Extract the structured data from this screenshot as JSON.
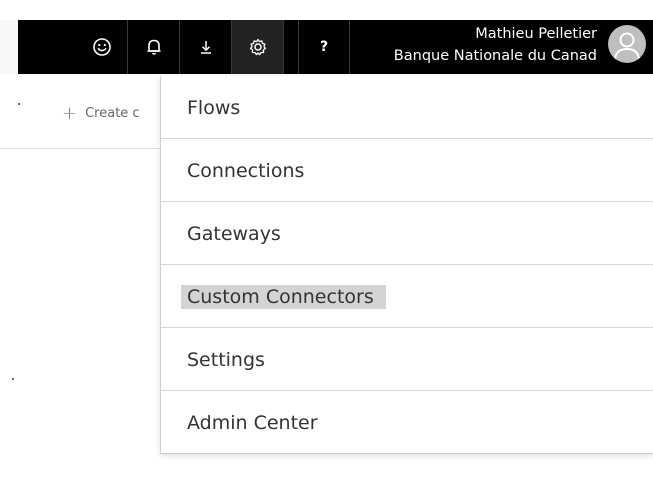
{
  "header": {
    "user_name": "Mathieu Pelletier",
    "user_org": "Banque Nationale du Canad",
    "buttons": [
      {
        "icon": "smiley-icon"
      },
      {
        "icon": "bell-icon"
      },
      {
        "icon": "download-icon"
      },
      {
        "icon": "gear-icon"
      },
      {
        "label": "?"
      }
    ]
  },
  "page": {
    "create_label": "Create c"
  },
  "menu": {
    "items": [
      {
        "label": "Flows"
      },
      {
        "label": "Connections"
      },
      {
        "label": "Gateways"
      },
      {
        "label": "Custom Connectors",
        "highlighted": true
      },
      {
        "label": "Settings"
      },
      {
        "label": "Admin Center"
      }
    ]
  },
  "colors": {
    "topbar": "#000000",
    "menu_text": "#333333",
    "highlight": "#d4d4d4",
    "avatar": "#bfbfbf"
  }
}
